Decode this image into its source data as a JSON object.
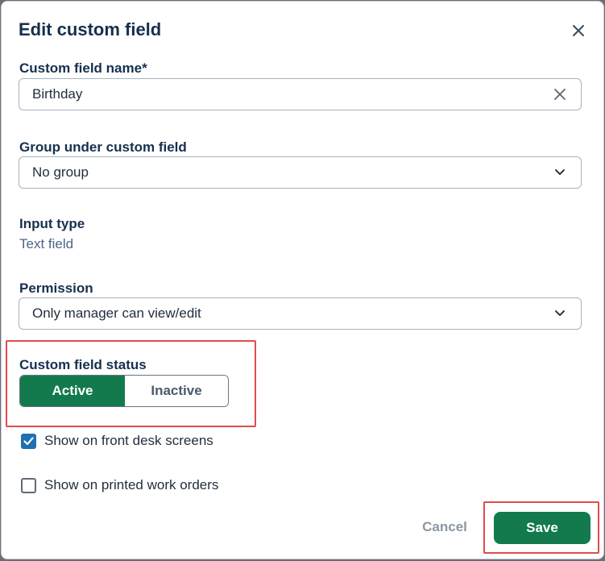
{
  "dialog": {
    "title": "Edit custom field"
  },
  "name_field": {
    "label": "Custom field name*",
    "value": "Birthday"
  },
  "group_field": {
    "label": "Group under custom field",
    "selected": "No group"
  },
  "input_type": {
    "label": "Input type",
    "value": "Text field"
  },
  "permission": {
    "label": "Permission",
    "selected": "Only manager can view/edit"
  },
  "status": {
    "label": "Custom field status",
    "options": [
      "Active",
      "Inactive"
    ],
    "selected": "Active"
  },
  "checkboxes": [
    {
      "label": "Show on front desk screens",
      "checked": true
    },
    {
      "label": "Show on printed work orders",
      "checked": false
    }
  ],
  "actions": {
    "cancel": "Cancel",
    "save": "Save"
  },
  "colors": {
    "primary_green": "#127a4c",
    "checkbox_blue": "#1f6fb2",
    "title_navy": "#16304d",
    "highlight_red": "#e24b4b"
  },
  "icons": {
    "close": "close-icon",
    "clear": "clear-icon",
    "dropdown": "chevron-down-icon",
    "check": "check-icon"
  }
}
